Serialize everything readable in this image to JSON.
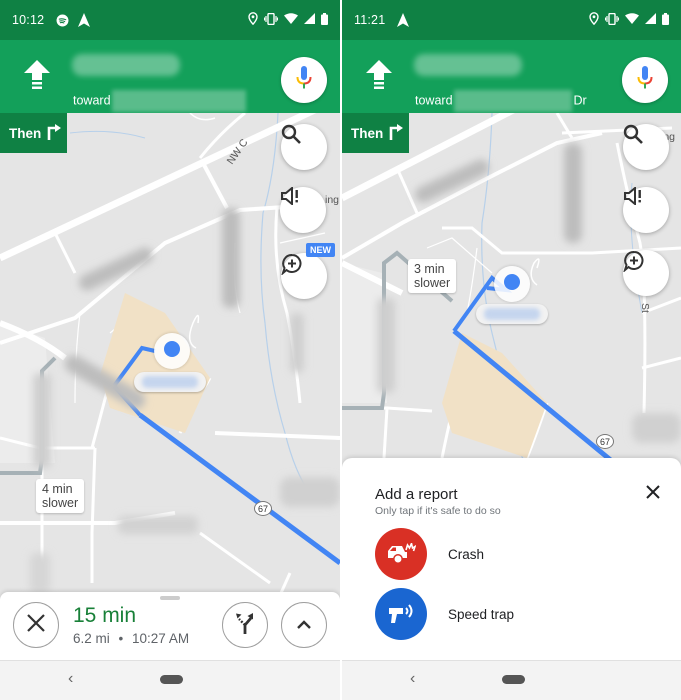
{
  "colors": {
    "statusbar": "#0f8144",
    "nav_header": "#13a05a",
    "route_blue": "#4285f4",
    "alt_route_gray": "#a6b1b6",
    "eta_green": "#188038",
    "crash_red": "#d93025",
    "speed_trap_blue": "#1a66d1",
    "new_badge": "#4285f4"
  },
  "left_screen": {
    "status_bar": {
      "time": "10:12",
      "left_icons": [
        "spotify-icon",
        "navigation-arrow-icon"
      ],
      "right_icons": [
        "location-pin-icon",
        "vibrate-icon",
        "wifi-icon",
        "cell-signal-icon",
        "battery-icon"
      ]
    },
    "nav_header": {
      "direction_icon": "straight-arrow-icon",
      "street_name": "",
      "toward_prefix": "toward",
      "toward_suffix": "",
      "mic_icon": "google-mic-icon"
    },
    "then_box": {
      "label": "Then",
      "icon": "turn-right-icon"
    },
    "map_buttons": [
      {
        "name": "search",
        "icon": "search-icon"
      },
      {
        "name": "sound",
        "icon": "sound-alert-icon"
      },
      {
        "name": "add-report",
        "icon": "add-report-icon",
        "badge": "NEW"
      }
    ],
    "map_labels": {
      "street_fragment": "NW C",
      "street_fragment_2": "ing",
      "alt_route": {
        "line1": "4 min",
        "line2": "slower"
      },
      "route_shield": "67"
    },
    "trip_panel": {
      "eta_duration": "15 min",
      "distance": "6.2 mi",
      "separator": "•",
      "arrival_time": "10:27 AM",
      "close_icon": "close-icon",
      "alternates_icon": "route-fork-icon",
      "expand_icon": "chevron-up-icon"
    },
    "nav_bar": {
      "back_icon": "back-chevron-icon",
      "home_icon": "home-pill-icon"
    }
  },
  "right_screen": {
    "status_bar": {
      "time": "11:21",
      "left_icons": [
        "navigation-arrow-icon"
      ],
      "right_icons": [
        "location-pin-icon",
        "vibrate-icon",
        "wifi-icon",
        "cell-signal-icon",
        "battery-icon"
      ]
    },
    "nav_header": {
      "direction_icon": "straight-arrow-icon",
      "street_name": "",
      "toward_prefix": "toward",
      "toward_suffix": "Dr",
      "mic_icon": "google-mic-icon"
    },
    "then_box": {
      "label": "Then",
      "icon": "turn-right-icon"
    },
    "map_buttons": [
      {
        "name": "search",
        "icon": "search-icon"
      },
      {
        "name": "sound",
        "icon": "sound-alert-icon"
      },
      {
        "name": "add-report",
        "icon": "add-report-icon"
      }
    ],
    "map_labels": {
      "street_fragment": "ing",
      "street_fragment_2": "St",
      "alt_route": {
        "line1": "3 min",
        "line2": "slower"
      },
      "route_shield": "67"
    },
    "report_sheet": {
      "title": "Add a report",
      "subtitle": "Only tap if it's safe to do so",
      "close_icon": "close-icon",
      "items": [
        {
          "label": "Crash",
          "icon": "crash-icon",
          "color": "#d93025"
        },
        {
          "label": "Speed trap",
          "icon": "speed-trap-icon",
          "color": "#1a66d1"
        }
      ]
    },
    "nav_bar": {
      "back_icon": "back-chevron-icon",
      "home_icon": "home-pill-icon"
    }
  }
}
